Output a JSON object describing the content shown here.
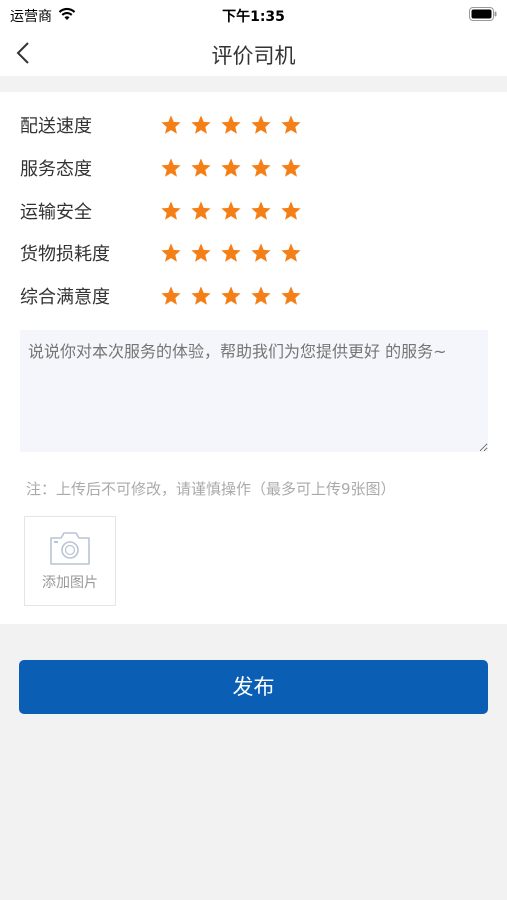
{
  "status_bar": {
    "carrier": "运营商",
    "time": "下午1:35"
  },
  "nav": {
    "title": "评价司机"
  },
  "ratings": [
    {
      "label": "配送速度",
      "stars": 5
    },
    {
      "label": "服务态度",
      "stars": 5
    },
    {
      "label": "运输安全",
      "stars": 5
    },
    {
      "label": "货物损耗度",
      "stars": 5
    },
    {
      "label": "综合满意度",
      "stars": 5
    }
  ],
  "comment": {
    "placeholder": "说说你对本次服务的体验，帮助我们为您提供更好 的服务~",
    "value": ""
  },
  "note": "注：上传后不可修改，请谨慎操作（最多可上传9张图）",
  "upload": {
    "label": "添加图片",
    "icon": "camera-icon"
  },
  "publish_button": "发布",
  "colors": {
    "star": "#f57f17",
    "primary": "#0a5fb4",
    "input_bg": "#f4f6fb"
  }
}
